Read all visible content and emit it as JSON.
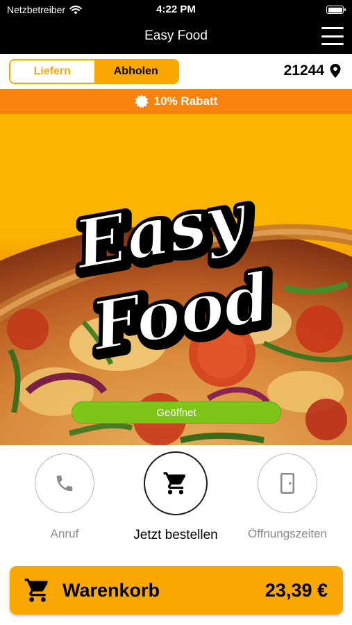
{
  "status_bar": {
    "carrier": "Netzbetreiber",
    "time": "4:22 PM",
    "wifi_icon": "wifi-icon",
    "battery_icon": "battery-icon"
  },
  "nav": {
    "title": "Easy Food",
    "menu_icon": "hamburger-menu-icon"
  },
  "order_mode": {
    "options": [
      "Liefern",
      "Abholen"
    ],
    "selected": "Abholen",
    "accent_color": "#f8a800"
  },
  "location": {
    "zip": "21244",
    "icon": "location-pin-icon"
  },
  "promo": {
    "text": "10% Rabatt",
    "icon": "badge-icon",
    "color": "#f7820e"
  },
  "hero": {
    "logo_text": [
      "Easy",
      "Food"
    ],
    "status": "Geöffnet",
    "status_color": "#7ec51a",
    "background_color": "#fbb500"
  },
  "actions": [
    {
      "label": "Anruf",
      "icon": "phone-icon"
    },
    {
      "label": "Jetzt bestellen",
      "icon": "cart-icon"
    },
    {
      "label": "Öffnungszeiten",
      "icon": "door-icon"
    }
  ],
  "cart": {
    "label": "Warenkorb",
    "total": "23,39 €",
    "icon": "cart-icon",
    "color": "#f8a800"
  }
}
